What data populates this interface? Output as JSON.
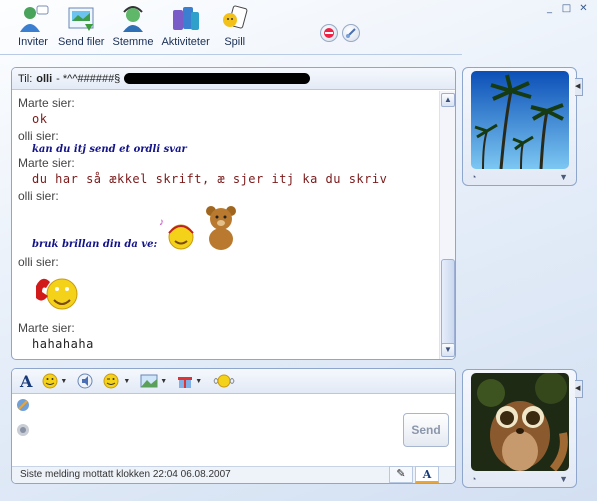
{
  "window": {
    "minimize": "_",
    "maximize": "□",
    "close": "✕"
  },
  "toolbar": {
    "items": [
      {
        "label": "Inviter",
        "icon": "invite-icon"
      },
      {
        "label": "Send filer",
        "icon": "send-files-icon"
      },
      {
        "label": "Stemme",
        "icon": "voice-icon"
      },
      {
        "label": "Aktiviteter",
        "icon": "activities-icon"
      },
      {
        "label": "Spill",
        "icon": "games-icon"
      }
    ],
    "block_icon": "block-icon",
    "background_icon": "background-icon"
  },
  "conversation": {
    "to_label": "Til:",
    "to_name": "olli",
    "to_status": "- *^^######§",
    "messages": [
      {
        "sender": "Marte sier:",
        "text": "ok",
        "style": "red"
      },
      {
        "sender": "olli sier:",
        "text": "kan du itj send et ordli svar",
        "style": "handwriting"
      },
      {
        "sender": "Marte sier:",
        "text": "du har så ækkel skrift, æ sjer itj ka du skriv",
        "style": "red"
      },
      {
        "sender": "olli sier:",
        "text": "bruk brillan din da ve:",
        "style": "handwriting"
      },
      {
        "sender": "olli sier:",
        "text": "",
        "style": "emoticon"
      },
      {
        "sender": "Marte sier:",
        "text": "hahahaha",
        "style": "plain"
      }
    ]
  },
  "compose": {
    "send_label": "Send",
    "status": "Siste melding mottatt klokken 22:04 06.08.2007",
    "font_icon_label": "A",
    "mode_tabs": [
      "✎",
      "A"
    ]
  },
  "colors": {
    "accent": "#8ea6cc",
    "handwriting": "#12128a",
    "message_red": "#7a1a1a"
  }
}
